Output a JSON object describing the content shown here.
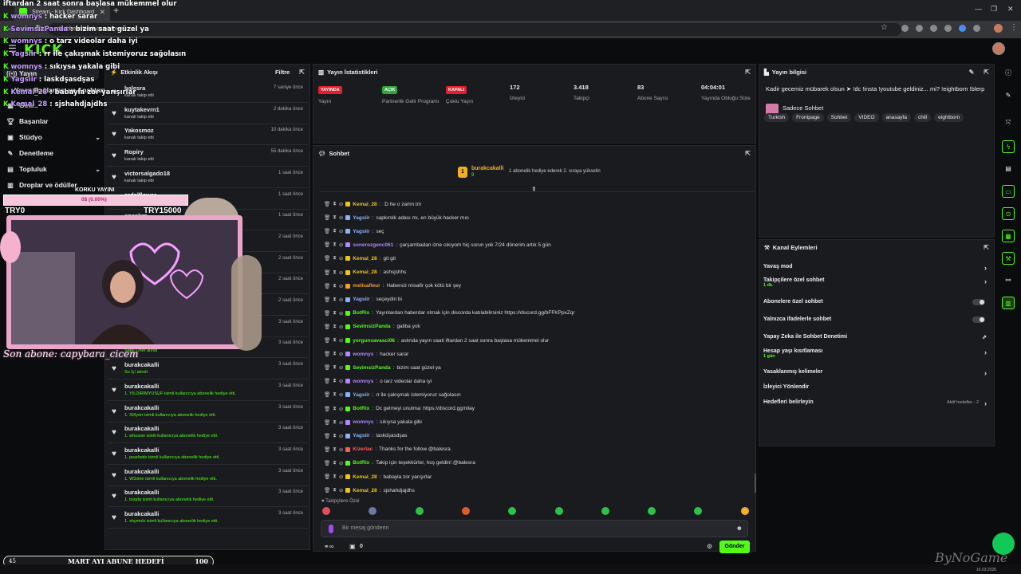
{
  "browser": {
    "tab_title": "Stream - Kick Dashboard",
    "url_host": "dashboard.kick.com",
    "url_path": "/stream"
  },
  "brand": {
    "logo": "KICK",
    "accent": "#53fc18"
  },
  "sidebar": {
    "items": [
      {
        "label": "Yayın",
        "icon": "broadcast-icon"
      },
      {
        "label": "Yayın Bağlantısı ve Anahtarı",
        "icon": ""
      },
      {
        "label": "Gelir",
        "icon": "money-icon"
      },
      {
        "label": "Başarılar",
        "icon": "trophy-icon"
      },
      {
        "label": "Stüdyo",
        "icon": "studio-icon"
      },
      {
        "label": "Denetleme",
        "icon": "shield-icon"
      },
      {
        "label": "Topluluk",
        "icon": "community-icon"
      },
      {
        "label": "Droplar ve ödüller",
        "icon": "gift-icon"
      }
    ]
  },
  "activity": {
    "title": "Etkinlik Akışı",
    "filter_label": "Filtre",
    "items": [
      {
        "name": "balesra",
        "sub": "kanalı takip etti",
        "time": "7 saniye önce"
      },
      {
        "name": "kuytakevrn1",
        "sub": "kanalı takip etti",
        "time": "2 dakika önce"
      },
      {
        "name": "Yakosmoz",
        "sub": "kanalı takip etti",
        "time": "10 dakika önce"
      },
      {
        "name": "Ropiry",
        "sub": "kanalı takip etti",
        "time": "55 dakika önce"
      },
      {
        "name": "victorsalgado18",
        "sub": "kanalı takip etti",
        "time": "1 saat önce"
      },
      {
        "name": "ardalflower",
        "sub": "",
        "time": "1 saat önce"
      },
      {
        "name": "eneskrp",
        "sub": "",
        "time": "1 saat önce"
      },
      {
        "name": "",
        "sub": "",
        "time": "2 saat önce"
      },
      {
        "name": "",
        "sub": "",
        "time": "2 saat önce"
      },
      {
        "name": "",
        "sub": "",
        "time": "2 saat önce"
      },
      {
        "name": "",
        "sub": "",
        "time": "2 saat önce"
      },
      {
        "name": "",
        "sub": "",
        "time": "3 saat önce"
      },
      {
        "name": "Harun_kikk",
        "sub": "Şarkı Öner alındı",
        "time": "3 saat önce"
      },
      {
        "name": "burakcakalli",
        "sub": "Su İç! alındı",
        "time": "3 saat önce"
      },
      {
        "name": "burakcakalli",
        "sub": "1. YILDIRIMYUSUF isimli kullanıcıya abonelik hediye etti.",
        "time": "3 saat önce"
      },
      {
        "name": "burakcakalli",
        "sub": "1. Sl4yerr isimli kullanıcıya abonelik hediye etti.",
        "time": "3 saat önce"
      },
      {
        "name": "burakcakalli",
        "sub": "1. whusow isimli kullanıcıya abonelik hediye etti.",
        "time": "3 saat önce"
      },
      {
        "name": "burakcakalli",
        "sub": "1. pearlwdo isimli kullanıcıya abonelik hediye etti.",
        "time": "3 saat önce"
      },
      {
        "name": "burakcakalli",
        "sub": "1. W3xlee isimli kullanıcıya abonelik hediye etti.",
        "time": "3 saat önce"
      },
      {
        "name": "burakcakalli",
        "sub": "1. bsqdq isimli kullanıcıya abonelik hediye etti.",
        "time": "3 saat önce"
      },
      {
        "name": "burakcakalli",
        "sub": "1. shymolx isimli kullanıcıya abonelik hediye etti.",
        "time": "3 saat önce"
      }
    ]
  },
  "stats": {
    "title": "Yayın İstatistikleri",
    "items": [
      {
        "badge": "YAYINDA",
        "badge_color": "#e0202e",
        "value": "",
        "label": "Yayın"
      },
      {
        "badge": "AÇIK",
        "badge_color": "#2fa53a",
        "value": "",
        "label": "Partnerlik Gelir Programı"
      },
      {
        "badge": "KAPALI",
        "badge_color": "#e0202e",
        "value": "",
        "label": "Çoklu Yayın"
      },
      {
        "badge": "",
        "value": "172",
        "label": "İzleyici"
      },
      {
        "badge": "",
        "value": "3.418",
        "label": "Takipçi"
      },
      {
        "badge": "",
        "value": "83",
        "label": "Abone Sayısı"
      },
      {
        "badge": "",
        "value": "04:04:01",
        "label": "Yayında Olduğu Süre"
      }
    ]
  },
  "chat": {
    "title": "Sohbet",
    "pinned_user": "burakcakalli",
    "pinned_count": "9",
    "pinned_text": "1 abonelik hediye ederek 2. sıraya yükselin",
    "messages": [
      {
        "user": "Kemal_28",
        "color": "#f0c419",
        "text": ":D he o zamn tm"
      },
      {
        "user": "Yagsiir",
        "color": "#8ab4f8",
        "text": "sapkınlık adası mı, en büyük hacker mıo"
      },
      {
        "user": "Yagsiir",
        "color": "#8ab4f8",
        "text": "seç"
      },
      {
        "user": "sonerozgenc061",
        "color": "#b388ff",
        "text": "çarşambadan izne cıkıyom hiç sorun yok 7/24 dönerim artık 5 gün"
      },
      {
        "user": "Kemal_28",
        "color": "#f0c419",
        "text": "git git"
      },
      {
        "user": "Kemal_28",
        "color": "#f0c419",
        "text": "ashsjshhs"
      },
      {
        "user": "melisafleur",
        "color": "#f0a030",
        "text": "Habersiz misafir çok kötü bir şey"
      },
      {
        "user": "Yagsiir",
        "color": "#8ab4f8",
        "text": "seçeydin bi"
      },
      {
        "user": "BotRix",
        "color": "#53fc18",
        "text": "Yayınlardan haberdar olmak için discorda katılabilirsiniz https://discord.gg/bFFKPpxZqr"
      },
      {
        "user": "SevimsizPanda",
        "color": "#53fc18",
        "text": "galiba yok"
      },
      {
        "user": "yorgunsavasci06",
        "color": "#53fc18",
        "text": "aslında yayın saati iftardan 2 saat sonra başlasa mükemmel olur"
      },
      {
        "user": "womnys",
        "color": "#b388ff",
        "text": "hacker sarar"
      },
      {
        "user": "SevimsizPanda",
        "color": "#53fc18",
        "text": "bizim saat güzel ya"
      },
      {
        "user": "womnys",
        "color": "#b388ff",
        "text": "o tarz videolar daha iyi"
      },
      {
        "user": "Yagsiir",
        "color": "#8ab4f8",
        "text": "rr ile çakışmak istemiyoruz sağolasın"
      },
      {
        "user": "BotRix",
        "color": "#53fc18",
        "text": "Dc gelmeyi unutma: https://discord.gg/nilay"
      },
      {
        "user": "womnys",
        "color": "#b388ff",
        "text": "sıkıysa yakala gibi"
      },
      {
        "user": "Yagsiir",
        "color": "#8ab4f8",
        "text": "laskdşasdşas"
      },
      {
        "user": "Kizerlac",
        "color": "#ff5b5b",
        "text": "Thanks for the follow @balesra"
      },
      {
        "user": "BotRix",
        "color": "#53fc18",
        "text": "Takip için teşekkürler, hoş geldin! @balesra"
      },
      {
        "user": "Kemal_28",
        "color": "#f0c419",
        "text": "babayla zor yarışırlar"
      },
      {
        "user": "Kemal_28",
        "color": "#f0c419",
        "text": "sjshahdjajdhs"
      }
    ],
    "followers_only_label": "Takipçilere Özel",
    "input_placeholder": "Bir mesaj gönderin",
    "send_label": "Gönder",
    "points": "0"
  },
  "info": {
    "title": "Yayın bilgisi",
    "description": "Kadir gecemiz mübarek olsun ➤ !dc !insta !youtube geldiniz... mi? !eightborn !blerp",
    "category": "Sadece Sohbet",
    "tags": [
      "Turkish",
      "Frontpage",
      "Sohbet",
      "VIDEO",
      "anasayfa",
      "chill",
      "eightborn"
    ]
  },
  "actions": {
    "title": "Kanal Eylemleri",
    "rows": [
      {
        "label": "Yavaş mod",
        "sub": "",
        "control": "chevron"
      },
      {
        "label": "Takipçilere özel sohbet",
        "sub": "1 dk.",
        "control": "chevron"
      },
      {
        "label": "Abonelere özel sohbet",
        "sub": "",
        "control": "toggle"
      },
      {
        "label": "Yalnızca ifadelerle sohbet",
        "sub": "",
        "control": "toggle"
      },
      {
        "label": "Yapay Zeka ile Sohbet Denetimi",
        "sub": "",
        "control": "external"
      },
      {
        "label": "Hesap yaşı kısıtlaması",
        "sub": "1 gün",
        "control": "chevron"
      },
      {
        "label": "Yasaklanmış kelimeler",
        "sub": "",
        "control": "chevron"
      },
      {
        "label": "İzleyici Yönlendir",
        "sub": "",
        "control": ""
      },
      {
        "label": "Hedefleri belirleyin",
        "sub": "",
        "control": "chevron",
        "note": "Aktif hedefler - 2"
      }
    ]
  },
  "overlay": {
    "goal_title": "KORKU YAYINI",
    "goal_progress_text": "0$ (0.00%)",
    "goal_progress": 0,
    "left_amount": "TRY0",
    "right_amount": "TRY15000",
    "last_sub": "Son abone: capybara_cicem",
    "chat_lines": [
      {
        "user": "",
        "text": "iftardan 2 saat sonra başlasa mükemmel olur"
      },
      {
        "user": "womnys",
        "text": "hacker sarar"
      },
      {
        "user": "SevimsizPanda",
        "text": "bizim saat güzel ya"
      },
      {
        "user": "womnys",
        "text": "o tarz videolar daha iyi"
      },
      {
        "user": "Yagsiir",
        "text": "rr ile çakışmak istemiyoruz sağolasın"
      },
      {
        "user": "womnys",
        "text": "sıkıysa yakala gibi"
      },
      {
        "user": "Yagsiir",
        "text": "laskdşasdşas"
      },
      {
        "user": "Kemal_28",
        "text": "babayla zor yarışırlar"
      },
      {
        "user": "Kemal_28",
        "text": "sjshahdjajdhs"
      }
    ],
    "sub_goal_left": "45",
    "sub_goal_title": "MART AYI ABUNE HEDEFİ",
    "sub_goal_right": "100"
  },
  "watermark": "ByNoGame",
  "clock": "16.03.2026"
}
